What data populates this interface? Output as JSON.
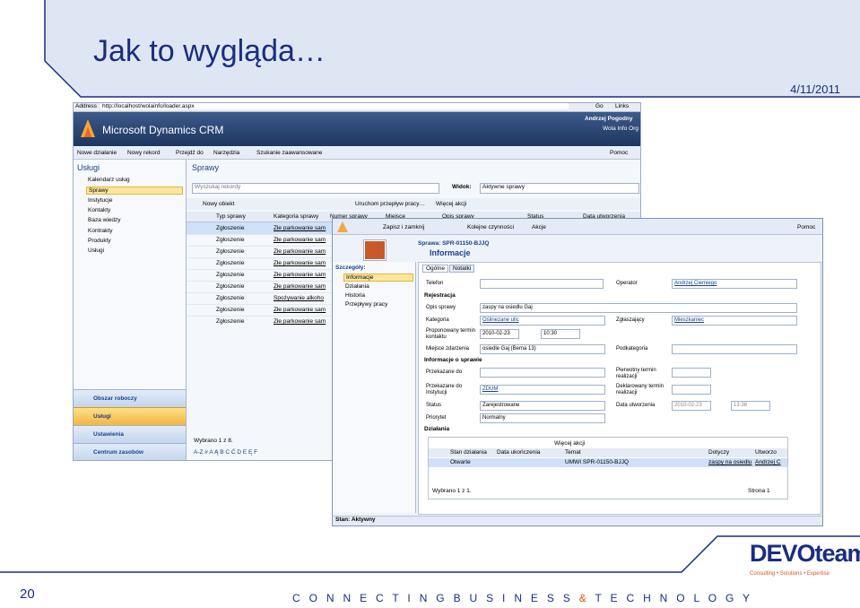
{
  "slide": {
    "title": "Jak to wygląda…",
    "date": "4/11/2011",
    "page_number": "20",
    "tagline_part1": "C O N N E C T I N G   B U S I N E S S",
    "tagline_amp": "&",
    "tagline_part2": "T E C H N O L O G Y",
    "logo_brand": "DEVOteam",
    "logo_sub": "Consulting • Solutions • Expertise"
  },
  "crm": {
    "address_label": "Address",
    "address_url": "http://localhost/wolainfo/loader.aspx",
    "go_label": "Go",
    "links_label": "Links",
    "app_name": "Microsoft Dynamics CRM",
    "user_name": "Andrzej Pogodny",
    "org_name": "Wola Info Org",
    "menu": [
      "Nowe działanie",
      "Nowy rekord",
      "Przejdź do",
      "Narzędzia",
      "Szukanie zaawansowane"
    ],
    "help_label": "Pomoc",
    "nav_header": "Usługi",
    "nav_items": [
      "Kalendarz usług",
      "Sprawy",
      "Instytucje",
      "Kontakty",
      "Baza wiedzy",
      "Kontrakty",
      "Produkty",
      "Usługi"
    ],
    "view_title": "Sprawy",
    "search_placeholder": "Wyszukaj rekordy",
    "view_label": "Widok:",
    "view_value": "Aktywne sprawy",
    "toolbar": [
      "Nowy obiekt",
      "Uruchom przepływ pracy…",
      "Więcej akcji"
    ],
    "columns": [
      "Typ sprawy",
      "Kategoria sprawy",
      "Numer sprawy",
      "Miejsce",
      "Opis sprawy",
      "Status",
      "Data utworzenia"
    ],
    "rows": [
      {
        "type": "Zgłoszenie",
        "category": "Złe parkowanie sam"
      },
      {
        "type": "Zgłoszenie",
        "category": "Złe parkowanie sam"
      },
      {
        "type": "Zgłoszenie",
        "category": "Złe parkowanie sam"
      },
      {
        "type": "Zgłoszenie",
        "category": "Złe parkowanie sam"
      },
      {
        "type": "Zgłoszenie",
        "category": "Złe parkowanie sam"
      },
      {
        "type": "Zgłoszenie",
        "category": "Złe parkowanie sam"
      },
      {
        "type": "Zgłoszenie",
        "category": "Spożywanie alkoho"
      },
      {
        "type": "Zgłoszenie",
        "category": "Złe parkowanie sam"
      },
      {
        "type": "Zgłoszenie",
        "category": "Złe parkowanie sam"
      }
    ],
    "selected_count": "Wybrano 1 z 8.",
    "alpha_bar": "A-Z  #  A  Ą  B  C  Ć  D  E  Ę  F",
    "bottom_nav": [
      "Obszar roboczy",
      "Usługi",
      "Ustawienia",
      "Centrum zasobów"
    ]
  },
  "detail": {
    "toolbar": [
      "Zapisz i zamknij",
      "Kolejne czynności",
      "Akcje"
    ],
    "help_label": "Pomoc",
    "record_title": "Sprawa: SPR-01150-BJJQ",
    "form_name": "Informacje",
    "details_header": "Szczegóły:",
    "details_items": [
      "Informacje",
      "Działania",
      "Historia",
      "Przepływy pracy"
    ],
    "tabs": [
      "Ogólne",
      "Notatki"
    ],
    "phone_label": "Telefon",
    "operator_label": "Operator",
    "operator_value": "Andrzej Ciemiego",
    "registration_header": "Rejestracja",
    "description_label": "Opis sprawy",
    "description_value": "zaspy na osiedlu Gaj",
    "category_label": "Kategoria",
    "category_value": "Oślinezane ulic",
    "reporter_label": "Zgłaszający",
    "reporter_value": "Mieszkaniec",
    "contact_label": "Proponowany termin kontaktu",
    "contact_date": "2010-02-23",
    "contact_time": "10:30",
    "place_label": "Miejsce zdarzenia",
    "place_value": "osiedle Gaj (Bema 13)",
    "subcategory_label": "Podkategoria",
    "info_header": "Informacje o sprawie",
    "passed_to_label": "Przekazane do",
    "first_deadline_label": "Pierwotny termin realizacji",
    "passed_inst_label": "Przekazane do Instytucji",
    "passed_inst_value": "ZDUM",
    "declared_deadline_label": "Deklarowany termin realizacji",
    "status_label": "Status",
    "status_value": "Zarejestrowane",
    "created_label": "Data utworzenia",
    "created_date": "2010-02-23",
    "created_time": "13:38",
    "priority_label": "Priorytet",
    "priority_value": "Normalny",
    "activities_header": "Działania",
    "activities_toolbar": "Więcej akcji",
    "act_columns": [
      "Stan działania",
      "Data ukończenia",
      "Temat",
      "Dotyczy",
      "Utworzo"
    ],
    "act_row": {
      "state": "Otwarte",
      "subject": "UMWI SPR-01150-BJJQ",
      "regarding": "zaspy na osiedlu",
      "creator": "Andrzej C"
    },
    "act_selected": "Wybrano 1 z 1.",
    "act_page": "Strona 1",
    "status_bar": "Stan: Aktywny"
  },
  "colors": {
    "title_blue": "#1b2d80",
    "accent_orange": "#e0531a",
    "header_band": "#dfe6f3"
  }
}
